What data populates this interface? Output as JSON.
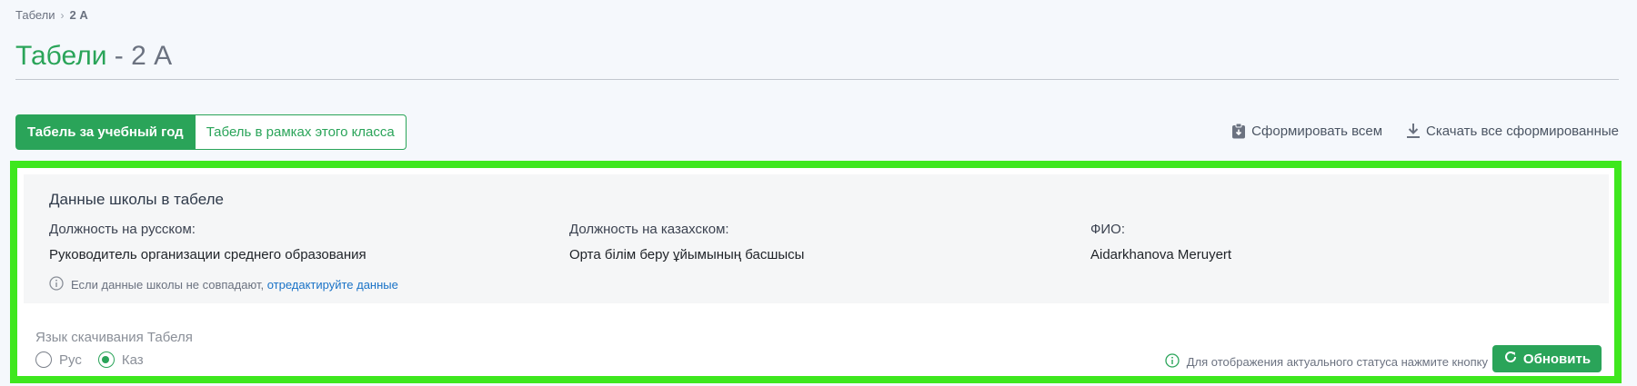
{
  "breadcrumb": {
    "parent": "Табели",
    "separator": "›",
    "current": "2 А"
  },
  "page": {
    "title_main": "Табели",
    "title_suffix": " - 2 А"
  },
  "tabs": [
    {
      "label": "Табель за учебный год",
      "active": true
    },
    {
      "label": "Табель в рамках этого класса",
      "active": false
    }
  ],
  "actions": {
    "generate_all": "Сформировать всем",
    "download_all": "Скачать все сформированные"
  },
  "school": {
    "title": "Данные школы в табеле",
    "fields": [
      {
        "label": "Должность на русском:",
        "value": "Руководитель организации среднего образования"
      },
      {
        "label": "Должность на казахском:",
        "value": "Орта білім беру ұйымының басшысы"
      },
      {
        "label": "ФИО:",
        "value": "Aidarkhanova Meruyert"
      }
    ],
    "note_text": "Если данные школы не совпадают, ",
    "note_link": "отредактируйте данные"
  },
  "language": {
    "label": "Язык скачивания Табеля",
    "options": [
      {
        "label": "Рус",
        "checked": false
      },
      {
        "label": "Каз",
        "checked": true
      }
    ]
  },
  "status_note": "Для отображения актуального статуса нажмите кнопку",
  "refresh_label": "Обновить",
  "colors": {
    "accent": "#2aa459",
    "highlight_border": "#3ee71e",
    "link": "#1a73c7"
  },
  "icons": {
    "generate_all": "clipboard-icon",
    "download_all": "download-icon",
    "info": "info-icon",
    "refresh": "refresh-icon"
  }
}
